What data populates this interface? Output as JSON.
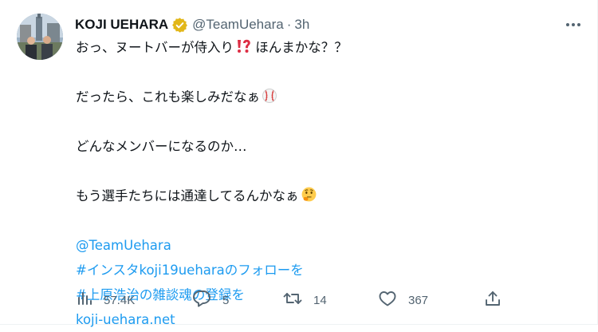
{
  "author": {
    "display_name": "KOJI UEHARA",
    "handle": "@TeamUehara",
    "separator": "·",
    "time": "3h"
  },
  "tweet": {
    "line1": "おっ、ヌートバーが侍入り",
    "line1_tail": " ほんまかな？？",
    "line2": "だったら、これも楽しみだなぁ",
    "line3": "どんなメンバーになるのか…",
    "line4": "もう選手たちには通達してるんかなぁ",
    "mention": "@TeamUehara",
    "hashtag1": "#インスタkoji19ueharaのフォローを",
    "hashtag2": "#上原浩治の雑談魂の登録を",
    "url": "koji-uehara.net"
  },
  "icons": {
    "verified": "verified-badge-icon",
    "more": "more-icon",
    "interrobang": "exclamation-question-emoji",
    "baseball": "baseball-emoji",
    "thinking": "thinking-face-emoji",
    "views": "views-icon",
    "reply": "reply-icon",
    "retweet": "retweet-icon",
    "like": "like-icon",
    "share": "share-icon"
  },
  "stats": {
    "views": "57.4K",
    "replies": "5",
    "retweets": "14",
    "likes": "367"
  },
  "colors": {
    "text": "#0f1419",
    "secondary": "#536471",
    "link": "#1d9bf0",
    "verified": "#e2b719"
  }
}
